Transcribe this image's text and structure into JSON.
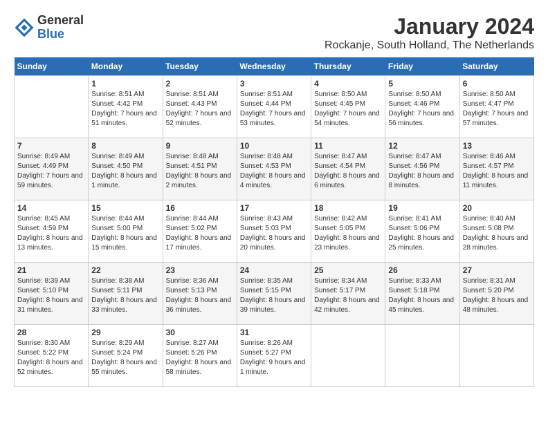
{
  "logo": {
    "general": "General",
    "blue": "Blue"
  },
  "title": "January 2024",
  "location": "Rockanje, South Holland, The Netherlands",
  "days_of_week": [
    "Sunday",
    "Monday",
    "Tuesday",
    "Wednesday",
    "Thursday",
    "Friday",
    "Saturday"
  ],
  "weeks": [
    [
      {
        "day": "",
        "sunrise": "",
        "sunset": "",
        "daylight": ""
      },
      {
        "day": "1",
        "sunrise": "Sunrise: 8:51 AM",
        "sunset": "Sunset: 4:42 PM",
        "daylight": "Daylight: 7 hours and 51 minutes."
      },
      {
        "day": "2",
        "sunrise": "Sunrise: 8:51 AM",
        "sunset": "Sunset: 4:43 PM",
        "daylight": "Daylight: 7 hours and 52 minutes."
      },
      {
        "day": "3",
        "sunrise": "Sunrise: 8:51 AM",
        "sunset": "Sunset: 4:44 PM",
        "daylight": "Daylight: 7 hours and 53 minutes."
      },
      {
        "day": "4",
        "sunrise": "Sunrise: 8:50 AM",
        "sunset": "Sunset: 4:45 PM",
        "daylight": "Daylight: 7 hours and 54 minutes."
      },
      {
        "day": "5",
        "sunrise": "Sunrise: 8:50 AM",
        "sunset": "Sunset: 4:46 PM",
        "daylight": "Daylight: 7 hours and 56 minutes."
      },
      {
        "day": "6",
        "sunrise": "Sunrise: 8:50 AM",
        "sunset": "Sunset: 4:47 PM",
        "daylight": "Daylight: 7 hours and 57 minutes."
      }
    ],
    [
      {
        "day": "7",
        "sunrise": "Sunrise: 8:49 AM",
        "sunset": "Sunset: 4:49 PM",
        "daylight": "Daylight: 7 hours and 59 minutes."
      },
      {
        "day": "8",
        "sunrise": "Sunrise: 8:49 AM",
        "sunset": "Sunset: 4:50 PM",
        "daylight": "Daylight: 8 hours and 1 minute."
      },
      {
        "day": "9",
        "sunrise": "Sunrise: 8:48 AM",
        "sunset": "Sunset: 4:51 PM",
        "daylight": "Daylight: 8 hours and 2 minutes."
      },
      {
        "day": "10",
        "sunrise": "Sunrise: 8:48 AM",
        "sunset": "Sunset: 4:53 PM",
        "daylight": "Daylight: 8 hours and 4 minutes."
      },
      {
        "day": "11",
        "sunrise": "Sunrise: 8:47 AM",
        "sunset": "Sunset: 4:54 PM",
        "daylight": "Daylight: 8 hours and 6 minutes."
      },
      {
        "day": "12",
        "sunrise": "Sunrise: 8:47 AM",
        "sunset": "Sunset: 4:56 PM",
        "daylight": "Daylight: 8 hours and 8 minutes."
      },
      {
        "day": "13",
        "sunrise": "Sunrise: 8:46 AM",
        "sunset": "Sunset: 4:57 PM",
        "daylight": "Daylight: 8 hours and 11 minutes."
      }
    ],
    [
      {
        "day": "14",
        "sunrise": "Sunrise: 8:45 AM",
        "sunset": "Sunset: 4:59 PM",
        "daylight": "Daylight: 8 hours and 13 minutes."
      },
      {
        "day": "15",
        "sunrise": "Sunrise: 8:44 AM",
        "sunset": "Sunset: 5:00 PM",
        "daylight": "Daylight: 8 hours and 15 minutes."
      },
      {
        "day": "16",
        "sunrise": "Sunrise: 8:44 AM",
        "sunset": "Sunset: 5:02 PM",
        "daylight": "Daylight: 8 hours and 17 minutes."
      },
      {
        "day": "17",
        "sunrise": "Sunrise: 8:43 AM",
        "sunset": "Sunset: 5:03 PM",
        "daylight": "Daylight: 8 hours and 20 minutes."
      },
      {
        "day": "18",
        "sunrise": "Sunrise: 8:42 AM",
        "sunset": "Sunset: 5:05 PM",
        "daylight": "Daylight: 8 hours and 23 minutes."
      },
      {
        "day": "19",
        "sunrise": "Sunrise: 8:41 AM",
        "sunset": "Sunset: 5:06 PM",
        "daylight": "Daylight: 8 hours and 25 minutes."
      },
      {
        "day": "20",
        "sunrise": "Sunrise: 8:40 AM",
        "sunset": "Sunset: 5:08 PM",
        "daylight": "Daylight: 8 hours and 28 minutes."
      }
    ],
    [
      {
        "day": "21",
        "sunrise": "Sunrise: 8:39 AM",
        "sunset": "Sunset: 5:10 PM",
        "daylight": "Daylight: 8 hours and 31 minutes."
      },
      {
        "day": "22",
        "sunrise": "Sunrise: 8:38 AM",
        "sunset": "Sunset: 5:11 PM",
        "daylight": "Daylight: 8 hours and 33 minutes."
      },
      {
        "day": "23",
        "sunrise": "Sunrise: 8:36 AM",
        "sunset": "Sunset: 5:13 PM",
        "daylight": "Daylight: 8 hours and 36 minutes."
      },
      {
        "day": "24",
        "sunrise": "Sunrise: 8:35 AM",
        "sunset": "Sunset: 5:15 PM",
        "daylight": "Daylight: 8 hours and 39 minutes."
      },
      {
        "day": "25",
        "sunrise": "Sunrise: 8:34 AM",
        "sunset": "Sunset: 5:17 PM",
        "daylight": "Daylight: 8 hours and 42 minutes."
      },
      {
        "day": "26",
        "sunrise": "Sunrise: 8:33 AM",
        "sunset": "Sunset: 5:18 PM",
        "daylight": "Daylight: 8 hours and 45 minutes."
      },
      {
        "day": "27",
        "sunrise": "Sunrise: 8:31 AM",
        "sunset": "Sunset: 5:20 PM",
        "daylight": "Daylight: 8 hours and 48 minutes."
      }
    ],
    [
      {
        "day": "28",
        "sunrise": "Sunrise: 8:30 AM",
        "sunset": "Sunset: 5:22 PM",
        "daylight": "Daylight: 8 hours and 52 minutes."
      },
      {
        "day": "29",
        "sunrise": "Sunrise: 8:29 AM",
        "sunset": "Sunset: 5:24 PM",
        "daylight": "Daylight: 8 hours and 55 minutes."
      },
      {
        "day": "30",
        "sunrise": "Sunrise: 8:27 AM",
        "sunset": "Sunset: 5:26 PM",
        "daylight": "Daylight: 8 hours and 58 minutes."
      },
      {
        "day": "31",
        "sunrise": "Sunrise: 8:26 AM",
        "sunset": "Sunset: 5:27 PM",
        "daylight": "Daylight: 9 hours and 1 minute."
      },
      {
        "day": "",
        "sunrise": "",
        "sunset": "",
        "daylight": ""
      },
      {
        "day": "",
        "sunrise": "",
        "sunset": "",
        "daylight": ""
      },
      {
        "day": "",
        "sunrise": "",
        "sunset": "",
        "daylight": ""
      }
    ]
  ]
}
